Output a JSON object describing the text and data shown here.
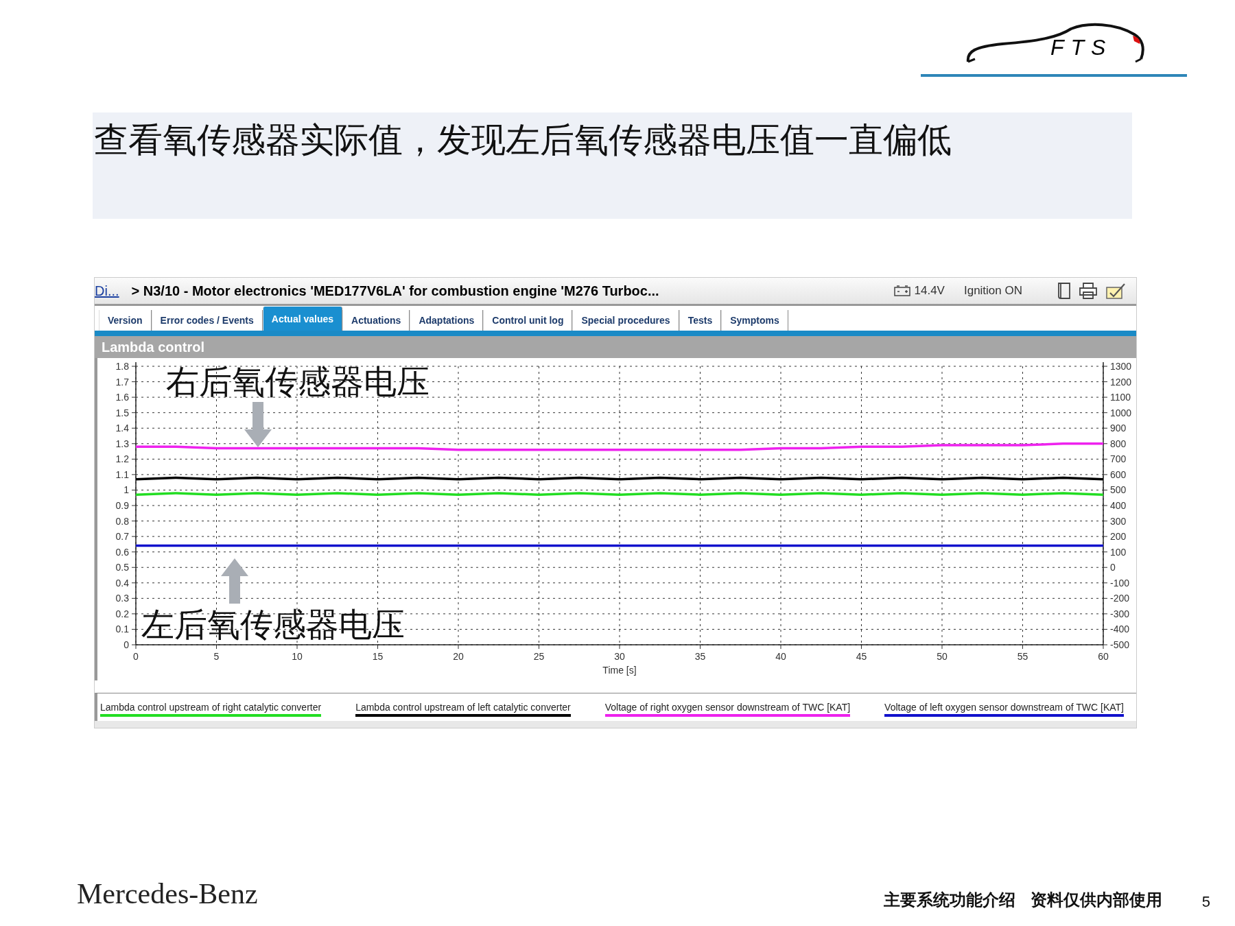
{
  "logo": {
    "text": "FTS"
  },
  "headline": "查看氧传感器实际值，发现左后氧传感器电压值一直偏低",
  "app": {
    "breadcrumb_link": "Di...",
    "breadcrumb": "> N3/10 - Motor electronics 'MED177V6LA' for combustion engine 'M276 Turboc...",
    "voltage": "14.4V",
    "ignition": "Ignition ON",
    "tabs": [
      {
        "label": "Version",
        "selected": false
      },
      {
        "label": "Error codes / Events",
        "selected": false
      },
      {
        "label": "Actual values",
        "selected": true
      },
      {
        "label": "Actuations",
        "selected": false
      },
      {
        "label": "Adaptations",
        "selected": false
      },
      {
        "label": "Control unit log",
        "selected": false
      },
      {
        "label": "Special procedures",
        "selected": false
      },
      {
        "label": "Tests",
        "selected": false
      },
      {
        "label": "Symptoms",
        "selected": false
      }
    ],
    "panel_title": "Lambda control",
    "chart_data": {
      "type": "line",
      "xlabel": "Time [s]",
      "x": [
        0,
        2.5,
        5,
        7.5,
        10,
        12.5,
        15,
        17.5,
        20,
        22.5,
        25,
        27.5,
        30,
        32.5,
        35,
        37.5,
        40,
        42.5,
        45,
        47.5,
        50,
        52.5,
        55,
        57.5,
        60
      ],
      "xlim": [
        0,
        60
      ],
      "ylim": [
        0,
        1.8
      ],
      "y2lim": [
        -500,
        1300
      ],
      "grid": true,
      "xticks": [
        0,
        5,
        10,
        15,
        20,
        25,
        30,
        35,
        40,
        45,
        50,
        55,
        60
      ],
      "yticks": [
        0,
        0.1,
        0.2,
        0.3,
        0.4,
        0.5,
        0.6,
        0.7,
        0.8,
        0.9,
        1,
        1.1,
        1.2,
        1.3,
        1.4,
        1.5,
        1.6,
        1.7,
        1.8
      ],
      "y2ticks": [
        -500,
        -400,
        -300,
        -200,
        -100,
        0,
        100,
        200,
        300,
        400,
        500,
        600,
        700,
        800,
        900,
        1000,
        1100,
        1200,
        1300
      ],
      "series": [
        {
          "name": "Lambda control upstream of right catalytic converter",
          "color": "#22dd22",
          "values": [
            0.97,
            0.98,
            0.97,
            0.98,
            0.97,
            0.98,
            0.97,
            0.98,
            0.97,
            0.98,
            0.97,
            0.98,
            0.97,
            0.98,
            0.97,
            0.98,
            0.97,
            0.98,
            0.97,
            0.98,
            0.97,
            0.98,
            0.97,
            0.98,
            0.97
          ]
        },
        {
          "name": "Lambda control upstream of left catalytic converter",
          "color": "#000000",
          "values": [
            1.07,
            1.08,
            1.07,
            1.08,
            1.07,
            1.08,
            1.07,
            1.08,
            1.07,
            1.08,
            1.07,
            1.08,
            1.07,
            1.08,
            1.07,
            1.08,
            1.07,
            1.08,
            1.07,
            1.08,
            1.07,
            1.08,
            1.07,
            1.08,
            1.07
          ]
        },
        {
          "name": "Voltage of right oxygen sensor downstream of TWC [KAT]",
          "color": "#ee22ee",
          "values": [
            1.28,
            1.28,
            1.27,
            1.27,
            1.27,
            1.27,
            1.27,
            1.27,
            1.26,
            1.26,
            1.26,
            1.26,
            1.26,
            1.26,
            1.26,
            1.26,
            1.27,
            1.27,
            1.28,
            1.28,
            1.29,
            1.29,
            1.29,
            1.3,
            1.3
          ]
        },
        {
          "name": "Voltage of left oxygen sensor downstream of TWC [KAT]",
          "color": "#1111cc",
          "values": [
            0.64,
            0.64,
            0.64,
            0.64,
            0.64,
            0.64,
            0.64,
            0.64,
            0.64,
            0.64,
            0.64,
            0.64,
            0.64,
            0.64,
            0.64,
            0.64,
            0.64,
            0.64,
            0.64,
            0.64,
            0.64,
            0.64,
            0.64,
            0.64,
            0.64
          ]
        }
      ]
    }
  },
  "callouts": [
    {
      "text": "右后氧传感器电压",
      "kind": "down"
    },
    {
      "text": "左后氧传感器电压",
      "kind": "up"
    }
  ],
  "footer": {
    "brand": "Mercedes-Benz",
    "note_1": "主要系统功能介绍",
    "note_2": "资料仅供内部使用",
    "page": "5"
  }
}
